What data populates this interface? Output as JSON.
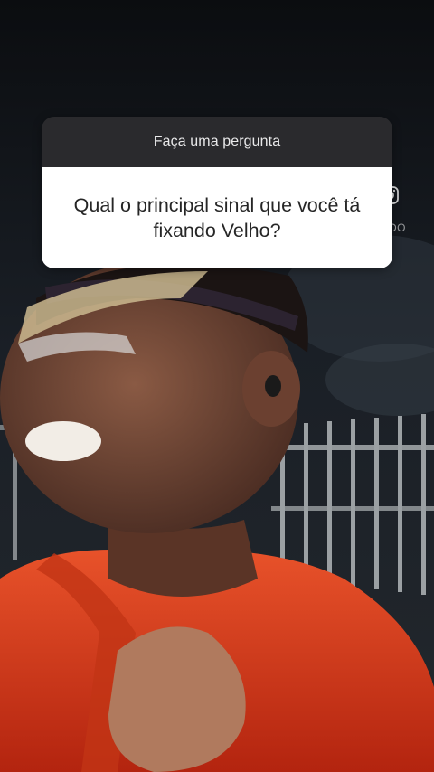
{
  "question_sticker": {
    "prompt": "Faça uma pergunta",
    "question": "Qual o principal sinal que você tá\nfixando Velho?"
  },
  "watermark": {
    "icon": "instagram-icon",
    "handle": "@FUTEGRUIDO"
  },
  "colors": {
    "sticker_header": "#2a2a2d",
    "sticker_body": "#ffffff",
    "question_text": "#262626",
    "shirt": "#e0401c"
  }
}
